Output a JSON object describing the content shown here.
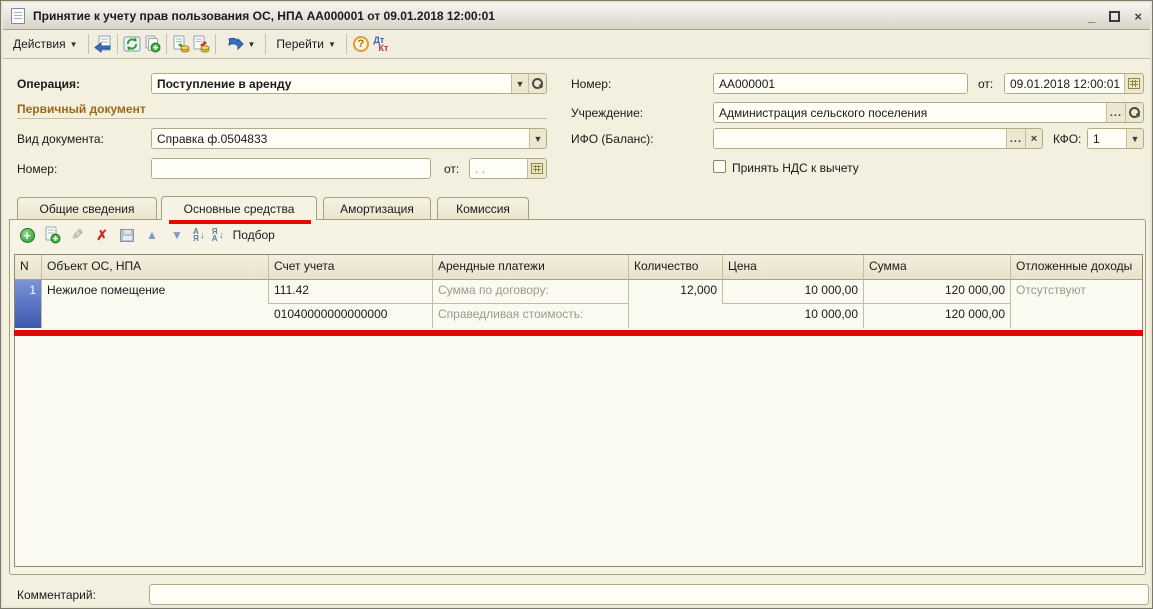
{
  "window": {
    "title": "Принятие к учету прав пользования ОС, НПА АА000001 от 09.01.2018 12:00:01",
    "controls": {
      "minimize": "_",
      "close": "×"
    }
  },
  "toolbar": {
    "actions_label": "Действия",
    "goto_label": "Перейти",
    "help_glyph": "?",
    "dt": "Дт",
    "kt": "Кт",
    "dropdown_glyph": "▼",
    "icon_names": [
      "save-and-close-icon",
      "refresh-icon",
      "copy-icon",
      "post-document-icon",
      "unpost-document-icon",
      "output-icon",
      "help-icon",
      "dt-kt-icon"
    ]
  },
  "fields": {
    "operation": {
      "label": "Операция:",
      "value": "Поступление в аренду"
    },
    "primary_doc_section": "Первичный документ",
    "doc_kind": {
      "label": "Вид документа:",
      "value": "Справка ф.0504833"
    },
    "doc_number": {
      "label": "Номер:",
      "value": "",
      "date_label": "от:",
      "date_value": ". ."
    },
    "number": {
      "label": "Номер:",
      "value": "АА000001",
      "date_label": "от:",
      "date_value": "09.01.2018 12:00:01"
    },
    "institution": {
      "label": "Учреждение:",
      "value": "Администрация сельского поселения"
    },
    "ifo": {
      "label": "ИФО (Баланс):",
      "value": "",
      "kfo_label": "КФО:",
      "kfo_value": "1"
    },
    "vat_checkbox_label": "Принять НДС к вычету",
    "ellipsis_glyph": "...",
    "clear_glyph": "×"
  },
  "tabs": [
    {
      "label": "Общие сведения",
      "active": false
    },
    {
      "label": "Основные средства",
      "active": true
    },
    {
      "label": "Амортизация",
      "active": false
    },
    {
      "label": "Комиссия",
      "active": false
    }
  ],
  "grid_toolbar": {
    "pick_label": "Подбор",
    "sort_asc": {
      "top": "А",
      "bottom": "Я"
    },
    "sort_desc": {
      "top": "Я",
      "bottom": "А"
    },
    "icon_names": [
      "add-icon",
      "copy-row-icon",
      "edit-icon",
      "delete-icon",
      "save-icon",
      "move-up-icon",
      "move-down-icon",
      "sort-asc-icon",
      "sort-desc-icon"
    ]
  },
  "table": {
    "columns": [
      "N",
      "Объект ОС, НПА",
      "Счет учета",
      "Арендные платежи",
      "Количество",
      "Цена",
      "Сумма",
      "Отложенные доходы"
    ],
    "rows": [
      {
        "n": "1",
        "object": "Нежилое помещение",
        "account_line1": "111.42",
        "account_line2": "01040000000000000",
        "rent_line1": "Сумма по договору:",
        "rent_line2": "Справедливая стоимость:",
        "qty": "12,000",
        "price_line1": "10 000,00",
        "price_line2": "10 000,00",
        "sum_line1": "120 000,00",
        "sum_line2": "120 000,00",
        "deferred": "Отсутствуют"
      }
    ]
  },
  "comment": {
    "label": "Комментарий:",
    "value": ""
  },
  "annotation_color": "#e20a00"
}
